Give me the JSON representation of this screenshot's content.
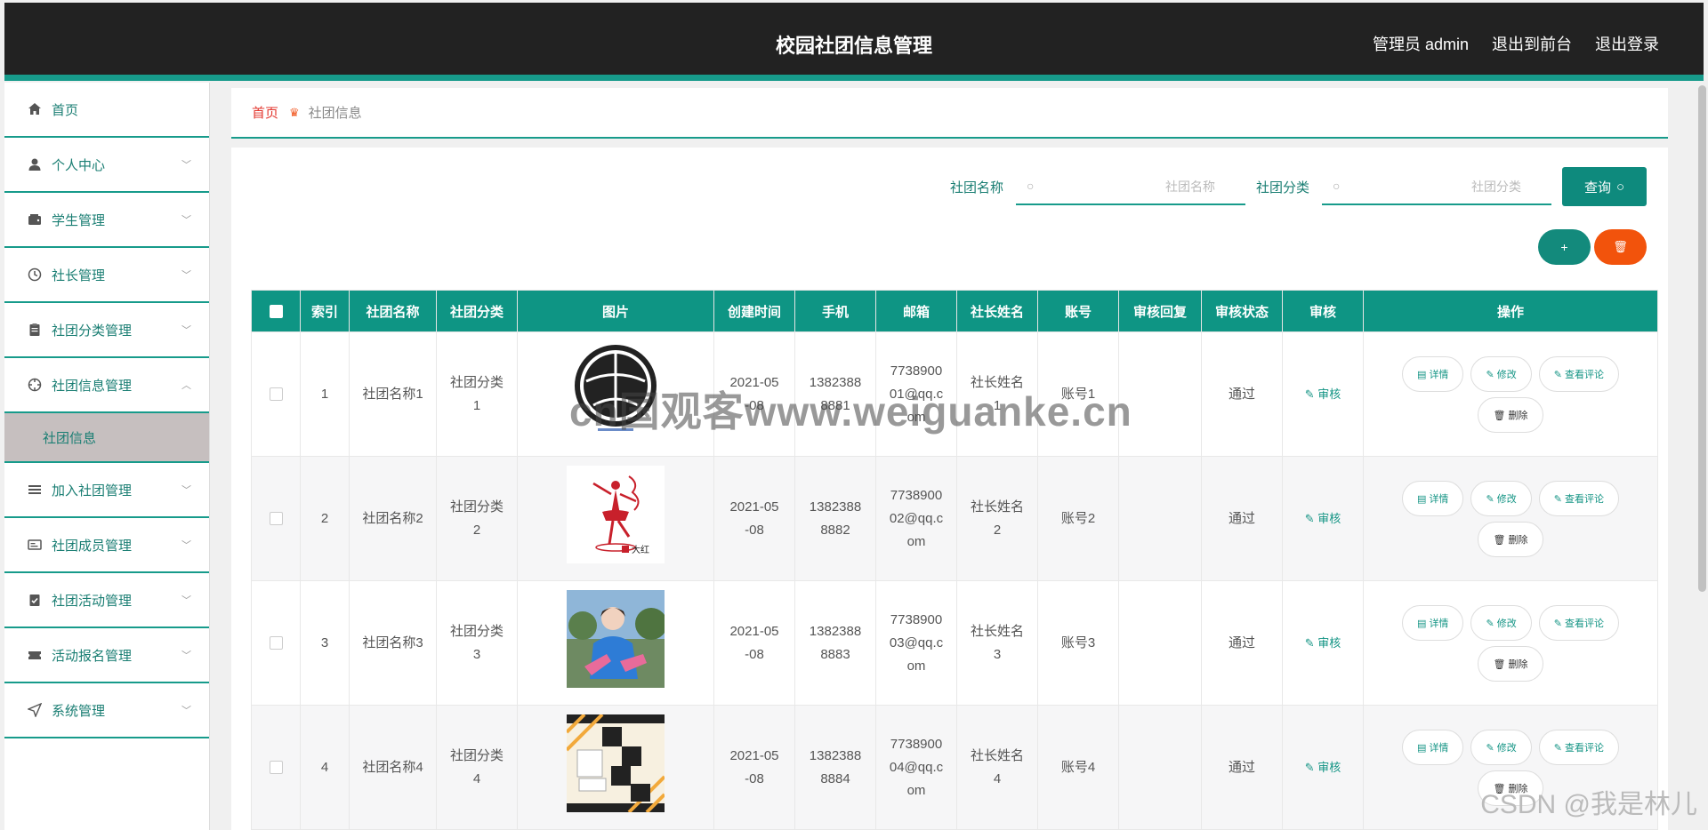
{
  "header": {
    "title": "校园社团信息管理",
    "admin_label": "管理员 admin",
    "to_front": "退出到前台",
    "logout": "退出登录"
  },
  "sidebar": {
    "items": [
      {
        "label": "首页",
        "icon": "home-icon"
      },
      {
        "label": "个人中心",
        "icon": "user-icon"
      },
      {
        "label": "学生管理",
        "icon": "wallet-icon"
      },
      {
        "label": "社长管理",
        "icon": "clock-icon"
      },
      {
        "label": "社团分类管理",
        "icon": "clipboard-icon"
      },
      {
        "label": "社团信息管理",
        "icon": "target-icon"
      },
      {
        "label": "加入社团管理",
        "icon": "list-icon"
      },
      {
        "label": "社团成员管理",
        "icon": "card-icon"
      },
      {
        "label": "社团活动管理",
        "icon": "checklist-icon"
      },
      {
        "label": "活动报名管理",
        "icon": "ticket-icon"
      },
      {
        "label": "系统管理",
        "icon": "send-icon"
      }
    ],
    "submenu_active": "社团信息"
  },
  "breadcrumb": {
    "home": "首页",
    "current": "社团信息"
  },
  "search": {
    "name_label": "社团名称",
    "name_placeholder": "社团名称",
    "type_label": "社团分类",
    "type_placeholder": "社团分类",
    "query_label": "查询"
  },
  "actions": {
    "add": "+",
    "delete": "🗑"
  },
  "table": {
    "columns": [
      "索引",
      "社团名称",
      "社团分类",
      "图片",
      "创建时间",
      "手机",
      "邮箱",
      "社长姓名",
      "账号",
      "审核回复",
      "审核状态",
      "审核",
      "操作"
    ],
    "rows": [
      {
        "index": "1",
        "name": "社团名称1",
        "type_a": "社团分类",
        "type_b": "1",
        "date_a": "2021-05",
        "date_b": "-08",
        "phone_a": "1382388",
        "phone_b": "8881",
        "mail_a": "7738900",
        "mail_b": "01@qq.c",
        "mail_c": "om",
        "leader_a": "社长姓名",
        "leader_b": "1",
        "account": "账号1",
        "reply": "",
        "status": "通过",
        "audit": "审核"
      },
      {
        "index": "2",
        "name": "社团名称2",
        "type_a": "社团分类",
        "type_b": "2",
        "date_a": "2021-05",
        "date_b": "-08",
        "phone_a": "1382388",
        "phone_b": "8882",
        "mail_a": "7738900",
        "mail_b": "02@qq.c",
        "mail_c": "om",
        "leader_a": "社长姓名",
        "leader_b": "2",
        "account": "账号2",
        "reply": "",
        "status": "通过",
        "audit": "审核"
      },
      {
        "index": "3",
        "name": "社团名称3",
        "type_a": "社团分类",
        "type_b": "3",
        "date_a": "2021-05",
        "date_b": "-08",
        "phone_a": "1382388",
        "phone_b": "8883",
        "mail_a": "7738900",
        "mail_b": "03@qq.c",
        "mail_c": "om",
        "leader_a": "社长姓名",
        "leader_b": "3",
        "account": "账号3",
        "reply": "",
        "status": "通过",
        "audit": "审核"
      },
      {
        "index": "4",
        "name": "社团名称4",
        "type_a": "社团分类",
        "type_b": "4",
        "date_a": "2021-05",
        "date_b": "-08",
        "phone_a": "1382388",
        "phone_b": "8884",
        "mail_a": "7738900",
        "mail_b": "04@qq.c",
        "mail_c": "om",
        "leader_a": "社长姓名",
        "leader_b": "4",
        "account": "账号4",
        "reply": "",
        "status": "通过",
        "audit": "审核"
      }
    ],
    "op_labels": {
      "detail": "详情",
      "edit": "修改",
      "comments": "查看评论",
      "delete": "删除"
    }
  },
  "image_texts": {
    "dance_tag": "大红"
  },
  "watermark": "cn国观客www.weiguanke.cn",
  "csdn": "CSDN @我是林儿",
  "colors": {
    "primary": "#0e9584",
    "topbar": "#222222",
    "danger": "#f2530c",
    "breadcrumb_home": "#e3362e"
  }
}
